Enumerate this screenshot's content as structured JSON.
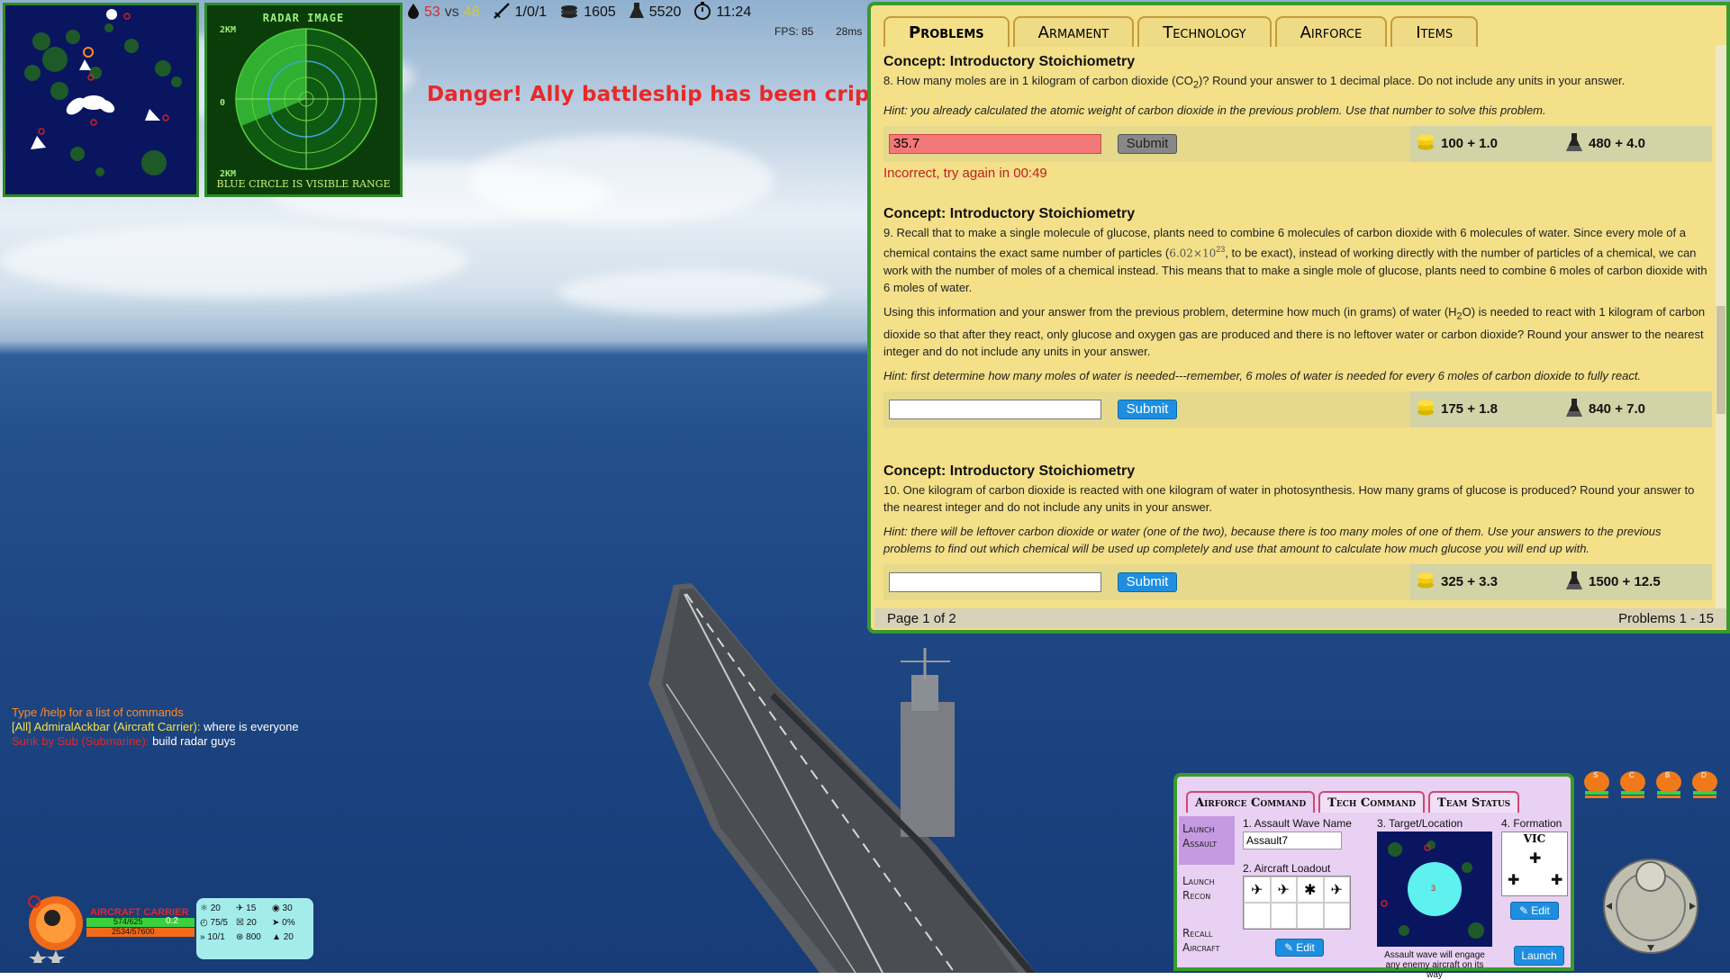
{
  "hud": {
    "score_left": "53",
    "vs_label": "vs",
    "score_right": "48",
    "kills": "1/0/1",
    "coins": "1605",
    "science": "5520",
    "timer": "11:24",
    "fps": "FPS: 85",
    "latency": "28ms"
  },
  "radar": {
    "title": "RADAR IMAGE",
    "top_label": "2KM",
    "mid_label": "0",
    "bottom_label": "2KM",
    "subtitle": "BLUE CIRCLE IS VISIBLE RANGE"
  },
  "alert": "Danger! Ally battleship has been crippled!",
  "problems_panel": {
    "tabs": [
      "Problems",
      "Armament",
      "Technology",
      "Airforce",
      "Items"
    ],
    "active_tab": "Problems",
    "footer_left": "Page 1 of 2",
    "footer_right": "Problems 1 - 15",
    "problems": [
      {
        "concept": "Concept: Introductory Stoichiometry",
        "text_pre": "8. How many moles are in 1 kilogram of carbon dioxide (CO",
        "text_sub": "2",
        "text_post": ")? Round your answer to 1 decimal place. Do not include any units in your answer.",
        "hint": "Hint: you already calculated the atomic weight of carbon dioxide in the previous problem. Use that number to solve this problem.",
        "answer": "35.7",
        "submit": "Submit",
        "feedback": "Incorrect, try again in 00:49",
        "reward_coins": "100 + 1.0",
        "reward_science": "480 + 4.0"
      },
      {
        "concept": "Concept: Introductory Stoichiometry",
        "para1_a": "9. Recall that to make a single molecule of glucose, plants need to combine 6 molecules of carbon dioxide with 6 molecules of water. Since every mole of a chemical contains the exact same number of particles (",
        "avogadro": "6.02×10",
        "avogadro_exp": "23",
        "para1_b": ", to be exact), instead of working directly with the number of particles of a chemical, we can work with the number of moles of a chemical instead. This means that to make a single mole of glucose, plants need to combine 6 moles of carbon dioxide with 6 moles of water.",
        "para2_a": "Using this information and your answer from the previous problem, determine how much (in grams) of water (H",
        "para2_sub": "2",
        "para2_b": "O) is needed to react with 1 kilogram of carbon dioxide so that after they react, only glucose and oxygen gas are produced and there is no leftover water or carbon dioxide? Round your answer to the nearest integer and do not include any units in your answer.",
        "hint": "Hint: first determine how many moles of water is needed---remember, 6 moles of water is needed for every 6 moles of carbon dioxide to fully react.",
        "answer": "",
        "submit": "Submit",
        "reward_coins": "175 + 1.8",
        "reward_science": "840 + 7.0"
      },
      {
        "concept": "Concept: Introductory Stoichiometry",
        "text": "10. One kilogram of carbon dioxide is reacted with one kilogram of water in photosynthesis. How many grams of glucose is produced? Round your answer to the nearest integer and do not include any units in your answer.",
        "hint": "Hint: there will be leftover carbon dioxide or water (one of the two), because there is too many moles of one of them. Use your answers to the previous problems to find out which chemical will be used up completely and use that amount to calculate how much glucose you will end up with.",
        "answer": "",
        "submit": "Submit",
        "reward_coins": "325 + 3.3",
        "reward_science": "1500 + 12.5"
      }
    ]
  },
  "chat": {
    "line1": "Type /help for a list of commands",
    "line2_sender": "[All] AdmiralAckbar (Aircraft Carrier):",
    "line2_msg": " where is everyone",
    "line3_sender": "Sunk by Sub (Submarine):",
    "line3_msg": " build radar guys"
  },
  "ship": {
    "type": "AIRCRAFT CARRIER",
    "hp": "574/625",
    "hp_delta": "0.2",
    "xp": "2534/57600",
    "stats": [
      {
        "icon": "shield-icon",
        "value": "20"
      },
      {
        "icon": "plane-icon",
        "value": "15"
      },
      {
        "icon": "radar-icon",
        "value": "30"
      },
      {
        "icon": "gauge-icon",
        "value": "75/5"
      },
      {
        "icon": "repair-icon",
        "value": "20"
      },
      {
        "icon": "torpedo-icon",
        "value": "0%"
      },
      {
        "icon": "speed-icon",
        "value": "10/1"
      },
      {
        "icon": "antenna-icon",
        "value": "800"
      },
      {
        "icon": "fuel-icon",
        "value": "20"
      }
    ]
  },
  "airforce": {
    "tabs": [
      "Airforce Command",
      "Tech Command",
      "Team Status"
    ],
    "side_buttons": [
      "Launch Assault",
      "Launch Recon",
      "Recall Aircraft"
    ],
    "label_wave": "1. Assault Wave Name",
    "wave_name": "Assault7",
    "label_loadout": "2. Aircraft Loadout",
    "label_target": "3. Target/Location",
    "label_formation": "4. Formation",
    "formation": "VIC",
    "edit_label": "Edit",
    "launch_label": "Launch",
    "note": "Assault wave will engage any enemy aircraft on its way",
    "target_marker": "3"
  },
  "team": [
    "S",
    "C",
    "B",
    "D"
  ],
  "colors": {
    "panel_bg": "#f3e089",
    "panel_border": "#3a9a2e",
    "submit_blue": "#1e8fe0",
    "alert_red": "#e8282a",
    "airforce_bg": "#e9d1f3"
  }
}
